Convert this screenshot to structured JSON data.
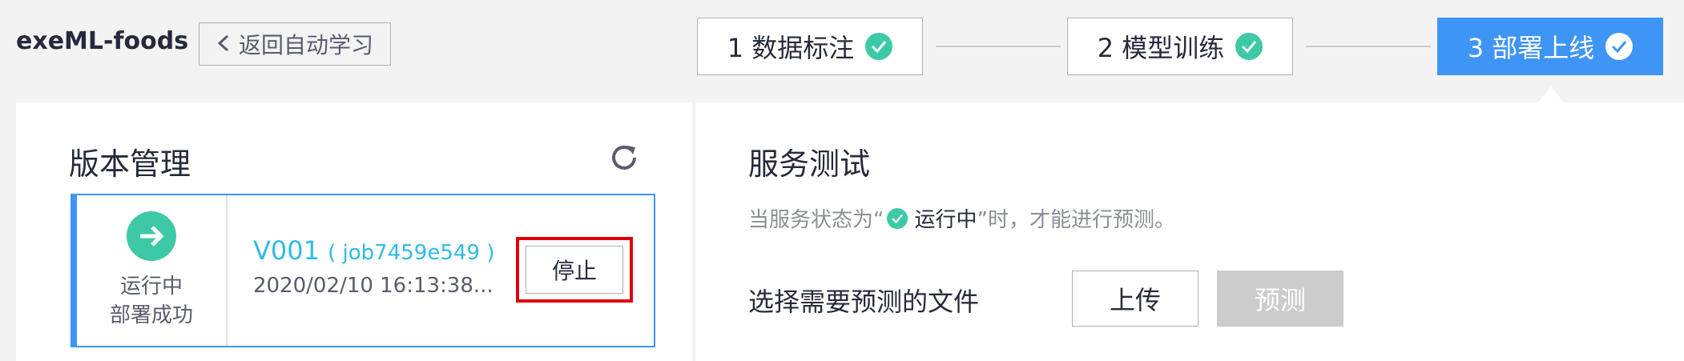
{
  "header": {
    "app_title": "exeML-foods",
    "back_label": "返回自动学习"
  },
  "steps": [
    {
      "label": "1 数据标注",
      "state": "done"
    },
    {
      "label": "2 模型训练",
      "state": "done"
    },
    {
      "label": "3 部署上线",
      "state": "active"
    }
  ],
  "version_panel": {
    "title": "版本管理",
    "card": {
      "status_line1": "运行中",
      "status_line2": "部署成功",
      "version": "V001",
      "job": "( job7459e549 )",
      "time": "2020/02/10 16:13:38...",
      "stop_label": "停止"
    }
  },
  "service_panel": {
    "title": "服务测试",
    "hint_prefix": "当服务状态为“",
    "hint_status": "运行中",
    "hint_suffix": "”时，才能进行预测。",
    "file_label": "选择需要预测的文件",
    "upload_label": "上传",
    "predict_label": "预测"
  },
  "colors": {
    "accent": "#3f95f5",
    "success": "#3dc9a5",
    "link": "#30bce6",
    "highlight_border": "#e0000b"
  },
  "icons": {
    "back": "chevron-left-icon",
    "step_done": "check-circle-icon",
    "refresh": "refresh-icon",
    "status": "arrow-right-circle-icon"
  }
}
